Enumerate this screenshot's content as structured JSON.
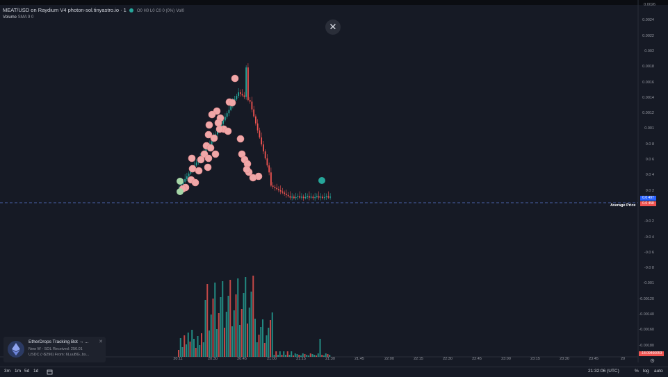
{
  "legend": {
    "symbol": "MEAT/USD on Raydium V4 photon-sol.tinyastro.io · 1",
    "ohlc": "O0 H0 L0 C0 0 (0%)",
    "vol_label": "Vol0",
    "volume_title": "Volume",
    "volume_params": "SMA 9",
    "volume_value": "0"
  },
  "chart": {
    "top_tag": "0.0024",
    "y_ticks": [
      "0.0026",
      "0.0024",
      "0.0022",
      "0.002",
      "0.0018",
      "0.0016",
      "0.0014",
      "0.0012",
      "0.001",
      "0.0 8",
      "0.0 6",
      "0.0 4",
      "0.0 2",
      "",
      "-0.0 2",
      "-0.0 4",
      "-0.0 6",
      "-0.0 8",
      "-0.001",
      "-0.00120",
      "-0.00140",
      "-0.00160",
      "-0.00180"
    ],
    "last_price_tag": "0.0 497",
    "avg_price_tag": "0.0 458",
    "avg_label": "Average Price",
    "bottom_tag": "-18.09466053",
    "x_ticks": [
      "20:11",
      "20:30",
      "20:45",
      "21:00",
      "21:15",
      "21:30",
      "21:45",
      "22:00",
      "22:15",
      "22:30",
      "22:45",
      "23:00",
      "23:15",
      "23:30",
      "23:45",
      "20"
    ],
    "colors": {
      "up": "#26a69a",
      "down": "#ef5350",
      "sell_marker": "#f0a7a8",
      "buy_marker": "#a5d6a7",
      "avg_line": "#5b7bd6"
    }
  },
  "toast": {
    "title": "EtherDrops Tracking Bot → ...",
    "line1": "New W - SOL Received: 256.01",
    "line2": "USDC (~$296) From: 6LuuBG..bs..."
  },
  "bottombar": {
    "ranges": [
      "3m",
      "1m",
      "5d",
      "1d"
    ],
    "clock": "21:32:06 (UTC)",
    "pct": "%",
    "log": "log",
    "auto": "auto"
  }
}
